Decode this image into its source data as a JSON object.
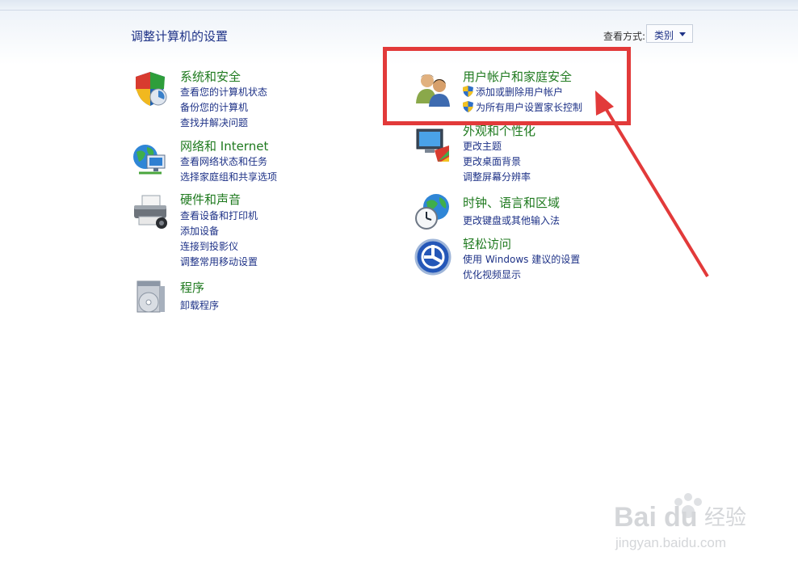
{
  "header": {
    "title": "调整计算机的设置",
    "view_by_label": "查看方式:",
    "view_by_value": "类别"
  },
  "categories": [
    {
      "name": "system-security",
      "title": "系统和安全",
      "icon": "shield-icon",
      "links": [
        "查看您的计算机状态",
        "备份您的计算机",
        "查找并解决问题"
      ]
    },
    {
      "name": "network",
      "title": "网络和 Internet",
      "icon": "network-globe-icon",
      "links": [
        "查看网络状态和任务",
        "选择家庭组和共享选项"
      ]
    },
    {
      "name": "hardware",
      "title": "硬件和声音",
      "icon": "printer-icon",
      "links": [
        "查看设备和打印机",
        "添加设备",
        "连接到投影仪",
        "调整常用移动设置"
      ]
    },
    {
      "name": "programs",
      "title": "程序",
      "icon": "programs-icon",
      "links": [
        "卸载程序"
      ]
    },
    {
      "name": "user-accounts",
      "title": "用户帐户和家庭安全",
      "icon": "users-icon",
      "links": [
        "添加或删除用户帐户",
        "为所有用户设置家长控制"
      ]
    },
    {
      "name": "appearance",
      "title": "外观和个性化",
      "icon": "monitor-paint-icon",
      "links": [
        "更改主题",
        "更改桌面背景",
        "调整屏幕分辨率"
      ]
    },
    {
      "name": "clock",
      "title": "时钟、语言和区域",
      "icon": "clock-globe-icon",
      "links": [
        "更改键盘或其他输入法"
      ]
    },
    {
      "name": "ease",
      "title": "轻松访问",
      "icon": "ease-of-access-icon",
      "links": [
        "使用 Windows 建议的设置",
        "优化视频显示"
      ]
    }
  ],
  "watermark": {
    "brand": "Baidu经验",
    "url": "jingyan.baidu.com"
  },
  "colors": {
    "title_green": "#1f7a1f",
    "link_blue": "#1e3287",
    "annotation_red": "#e23a3a"
  }
}
